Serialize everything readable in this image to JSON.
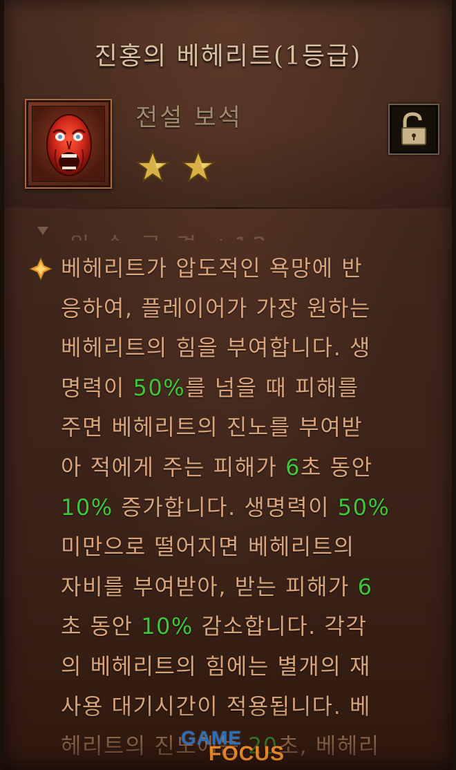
{
  "item": {
    "title": "진홍의 베헤리트(1등급)",
    "rarity": "전설 보석",
    "stars": 2,
    "portrait_icon": "screaming-red-face-icon",
    "lock_icon": "unlocked-padlock-icon"
  },
  "faded_stat": "원 속 공 경 +12",
  "description": {
    "lines": [
      [
        {
          "t": "베헤리트가 압도적인 욕망에 반"
        }
      ],
      [
        {
          "t": "응하여, 플레이어가 가장 원하는"
        }
      ],
      [
        {
          "t": "베헤리트의 힘을 부여합니다. 생"
        }
      ],
      [
        {
          "t": "명력이 "
        },
        {
          "t": "50%",
          "hl": true
        },
        {
          "t": "를 넘을 때 피해를"
        }
      ],
      [
        {
          "t": "주면 베헤리트의 진노를 부여받"
        }
      ],
      [
        {
          "t": "아 적에게 주는 피해가 "
        },
        {
          "t": "6",
          "hl": true
        },
        {
          "t": "초 동안"
        }
      ],
      [
        {
          "t": "10%",
          "hl": true
        },
        {
          "t": " 증가합니다. 생명력이 "
        },
        {
          "t": "50%",
          "hl": true
        }
      ],
      [
        {
          "t": "미만으로 떨어지면 베헤리트의"
        }
      ],
      [
        {
          "t": "자비를 부여받아, 받는 피해가 "
        },
        {
          "t": "6",
          "hl": true
        }
      ],
      [
        {
          "t": "초 동안 "
        },
        {
          "t": "10%",
          "hl": true
        },
        {
          "t": " 감소합니다. 각각"
        }
      ],
      [
        {
          "t": "의 베헤리트의 힘에는 별개의 재"
        }
      ],
      [
        {
          "t": "사용 대기시간이 적용됩니다. 베"
        }
      ],
      [
        {
          "t": "헤리트의 진노에는 "
        },
        {
          "t": "20",
          "hl": true
        },
        {
          "t": "초, 베헤리"
        }
      ]
    ]
  },
  "watermark": {
    "top": "GAME",
    "bottom": "FOCUS"
  },
  "colors": {
    "text": "#d8a47c",
    "highlight": "#3fc43a",
    "title": "#d8c0a0",
    "rarity": "#a08a6c",
    "star": "#d8b048",
    "background": "#3f261c"
  }
}
